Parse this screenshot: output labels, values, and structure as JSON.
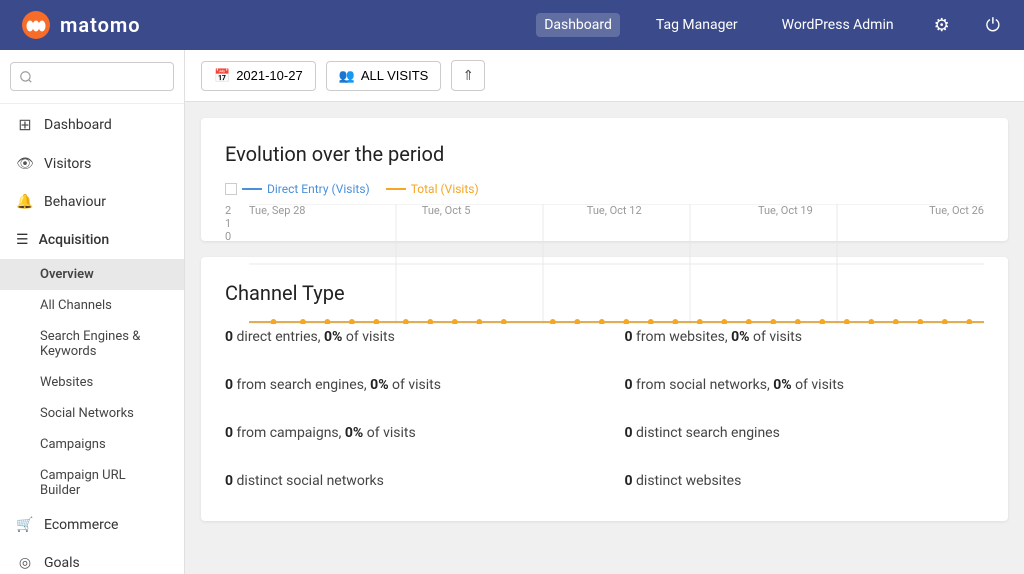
{
  "app": {
    "logo_text": "matomo"
  },
  "top_nav": {
    "links": [
      {
        "label": "Dashboard",
        "active": true
      },
      {
        "label": "Tag Manager",
        "active": false
      },
      {
        "label": "WordPress Admin",
        "active": false
      }
    ],
    "icons": [
      "settings",
      "logout"
    ]
  },
  "sidebar": {
    "search_placeholder": "",
    "items": [
      {
        "label": "Dashboard",
        "icon": "⊞",
        "type": "nav"
      },
      {
        "label": "Visitors",
        "icon": "👁",
        "type": "nav"
      },
      {
        "label": "Behaviour",
        "icon": "🔔",
        "type": "nav"
      },
      {
        "label": "Acquisition",
        "icon": "☰",
        "type": "section",
        "expanded": true,
        "children": [
          {
            "label": "Overview",
            "active": true
          },
          {
            "label": "All Channels",
            "active": false
          },
          {
            "label": "Search Engines & Keywords",
            "active": false
          },
          {
            "label": "Websites",
            "active": false
          },
          {
            "label": "Social Networks",
            "active": false
          },
          {
            "label": "Campaigns",
            "active": false
          },
          {
            "label": "Campaign URL Builder",
            "active": false
          }
        ]
      },
      {
        "label": "Ecommerce",
        "icon": "🛒",
        "type": "nav"
      },
      {
        "label": "Goals",
        "icon": "◎",
        "type": "nav"
      }
    ]
  },
  "toolbar": {
    "date": "2021-10-27",
    "date_icon": "📅",
    "segment_label": "ALL VISITS",
    "segment_icon": "👥",
    "collapse_icon": "⇑"
  },
  "chart": {
    "title": "Evolution over the period",
    "legend": [
      {
        "label": "Direct Entry (Visits)",
        "color": "#4a90d9",
        "type": "line"
      },
      {
        "label": "Total (Visits)",
        "color": "#f5a623",
        "type": "line"
      }
    ],
    "y_labels": [
      "2",
      "1",
      "0"
    ],
    "x_labels": [
      "Tue, Sep 28",
      "Tue, Oct 5",
      "Tue, Oct 12",
      "Tue, Oct 19",
      "Tue, Oct 26"
    ],
    "dots": [
      0,
      0,
      0,
      0,
      0,
      0,
      0,
      0,
      0,
      0,
      0,
      0,
      0,
      0,
      0,
      0,
      0,
      0,
      0,
      0,
      0,
      0,
      0,
      0,
      0,
      0,
      0,
      0,
      0
    ]
  },
  "channel_type": {
    "title": "Channel Type",
    "stats_left": [
      {
        "bold": "0",
        "text": " direct entries, ",
        "bold2": "0%",
        "text2": " of visits"
      },
      {
        "bold": "0",
        "text": " from search engines, ",
        "bold2": "0%",
        "text2": " of visits"
      },
      {
        "bold": "0",
        "text": " from campaigns, ",
        "bold2": "0%",
        "text2": " of visits"
      },
      {
        "bold": "0",
        "text": " distinct social networks",
        "bold2": "",
        "text2": ""
      }
    ],
    "stats_right": [
      {
        "bold": "0",
        "text": " from websites, ",
        "bold2": "0%",
        "text2": " of visits"
      },
      {
        "bold": "0",
        "text": " from social networks, ",
        "bold2": "0%",
        "text2": " of visits"
      },
      {
        "bold": "0",
        "text": " distinct search engines",
        "bold2": "",
        "text2": ""
      },
      {
        "bold": "0",
        "text": " distinct websites",
        "bold2": "",
        "text2": ""
      }
    ]
  }
}
